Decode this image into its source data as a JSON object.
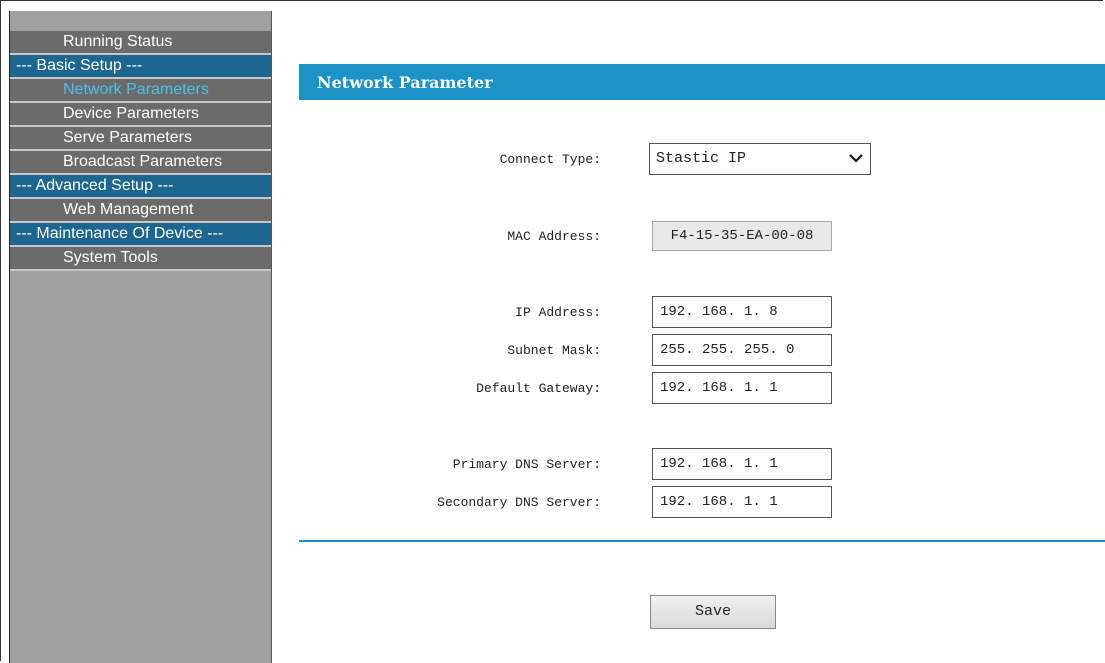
{
  "sidebar": {
    "items": [
      {
        "label": "Running Status",
        "type": "item"
      },
      {
        "label": "--- Basic Setup ---",
        "type": "section"
      },
      {
        "label": "Network Parameters",
        "type": "item",
        "active": true
      },
      {
        "label": "Device Parameters",
        "type": "item"
      },
      {
        "label": "Serve Parameters",
        "type": "item"
      },
      {
        "label": "Broadcast Parameters",
        "type": "item"
      },
      {
        "label": "--- Advanced Setup ---",
        "type": "section"
      },
      {
        "label": "Web Management",
        "type": "item"
      },
      {
        "label": "--- Maintenance Of Device ---",
        "type": "section"
      },
      {
        "label": "System Tools",
        "type": "item"
      }
    ]
  },
  "main": {
    "title": "Network Parameter",
    "connect_type": {
      "label": "Connect Type:",
      "value": "Stastic IP"
    },
    "mac_address": {
      "label": "MAC Address:",
      "value": "F4-15-35-EA-00-08"
    },
    "ip_address": {
      "label": "IP Address:",
      "value": "192. 168. 1. 8"
    },
    "subnet_mask": {
      "label": "Subnet Mask:",
      "value": "255. 255. 255. 0"
    },
    "default_gateway": {
      "label": "Default Gateway:",
      "value": "192. 168. 1. 1"
    },
    "primary_dns": {
      "label": "Primary DNS Server:",
      "value": "192. 168. 1. 1"
    },
    "secondary_dns": {
      "label": "Secondary DNS Server:",
      "value": "192. 168. 1. 1"
    },
    "save_label": "Save"
  },
  "colors": {
    "accent": "#1b93c6",
    "section_bg": "#1c6690",
    "item_bg": "#6b6b6b",
    "active_text": "#49c2ee"
  }
}
